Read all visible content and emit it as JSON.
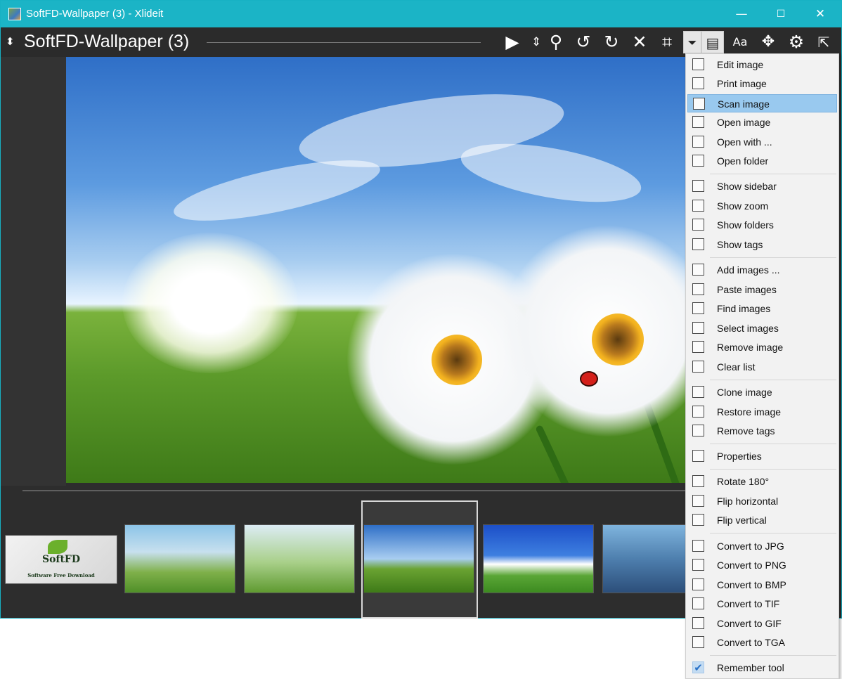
{
  "window": {
    "title": "SoftFD-Wallpaper (3) - Xlideit",
    "controls": {
      "minimize": "—",
      "maximize": "☐",
      "close": "✕"
    }
  },
  "toolbar": {
    "image_title": "SoftFD-Wallpaper (3)",
    "buttons": [
      {
        "name": "play-icon",
        "glyph": "▶"
      },
      {
        "name": "sort-icon",
        "glyph": "⇕"
      },
      {
        "name": "zoom-icon",
        "glyph": "⚲"
      },
      {
        "name": "rotate-left-icon",
        "glyph": "↺"
      },
      {
        "name": "rotate-right-icon",
        "glyph": "↻"
      },
      {
        "name": "close-image-icon",
        "glyph": "✕"
      },
      {
        "name": "crop-icon",
        "glyph": "⌗"
      },
      {
        "name": "dropdown-icon",
        "glyph": "⏷"
      },
      {
        "name": "sidebar-icon",
        "glyph": "▤"
      },
      {
        "name": "text-icon",
        "glyph": "Aa"
      },
      {
        "name": "move-icon",
        "glyph": "✥"
      },
      {
        "name": "settings-icon",
        "glyph": "⚙"
      },
      {
        "name": "fullscreen-icon",
        "glyph": "⇱"
      }
    ]
  },
  "thumbnails": {
    "logo": {
      "title": "SoftFD",
      "subtitle": "Software Free Download"
    }
  },
  "menu": {
    "items": [
      {
        "label": "Edit image",
        "icon": "edit-icon"
      },
      {
        "label": "Print image",
        "icon": "print-icon"
      },
      {
        "label": "Scan image",
        "icon": "scan-icon",
        "highlighted": true
      },
      {
        "label": "Open image",
        "icon": "open-image-icon"
      },
      {
        "label": "Open with ...",
        "icon": "open-with-icon"
      },
      {
        "label": "Open folder",
        "icon": "open-folder-icon"
      },
      {
        "label": "Show sidebar",
        "icon": "sidebar-icon"
      },
      {
        "label": "Show zoom",
        "icon": "zoom-icon"
      },
      {
        "label": "Show folders",
        "icon": "folders-icon"
      },
      {
        "label": "Show tags",
        "icon": "tags-icon"
      },
      {
        "label": "Add images ...",
        "icon": "add-images-icon"
      },
      {
        "label": "Paste images",
        "icon": "paste-icon"
      },
      {
        "label": "Find images",
        "icon": "find-icon"
      },
      {
        "label": "Select images",
        "icon": "select-icon"
      },
      {
        "label": "Remove image",
        "icon": "remove-icon"
      },
      {
        "label": "Clear list",
        "icon": "clear-list-icon"
      },
      {
        "label": "Clone image",
        "icon": "clone-icon"
      },
      {
        "label": "Restore image",
        "icon": "restore-icon"
      },
      {
        "label": "Remove tags",
        "icon": "remove-tags-icon"
      },
      {
        "label": "Properties",
        "icon": "properties-icon"
      },
      {
        "label": "Rotate 180°",
        "icon": "rotate-180-icon"
      },
      {
        "label": "Flip horizontal",
        "icon": "flip-horizontal-icon"
      },
      {
        "label": "Flip vertical",
        "icon": "flip-vertical-icon"
      },
      {
        "label": "Convert to JPG",
        "icon": "convert-jpg-icon"
      },
      {
        "label": "Convert to PNG",
        "icon": "convert-png-icon"
      },
      {
        "label": "Convert to BMP",
        "icon": "convert-bmp-icon"
      },
      {
        "label": "Convert to TIF",
        "icon": "convert-tif-icon"
      },
      {
        "label": "Convert to GIF",
        "icon": "convert-gif-icon"
      },
      {
        "label": "Convert to TGA",
        "icon": "convert-tga-icon"
      },
      {
        "label": "Remember tool",
        "icon": "check-icon",
        "checked": true
      }
    ]
  }
}
